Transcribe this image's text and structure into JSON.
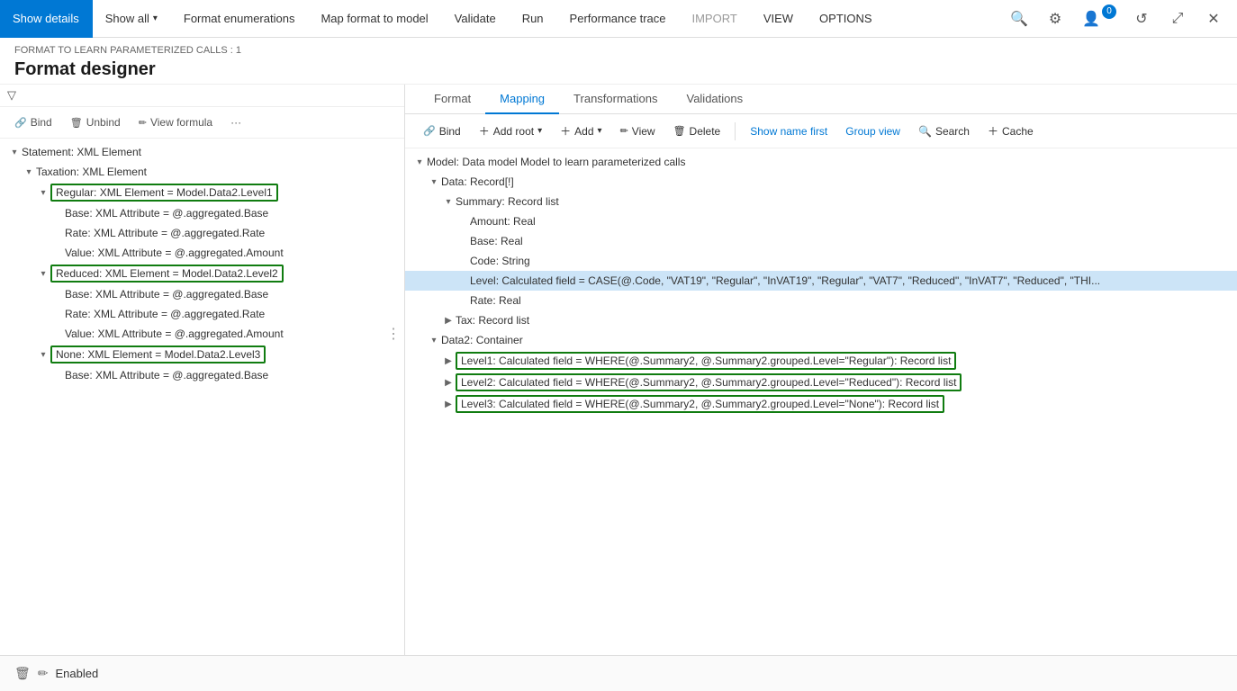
{
  "topbar": {
    "items": [
      {
        "id": "show-details",
        "label": "Show details",
        "active": true
      },
      {
        "id": "show-all",
        "label": "Show all",
        "has_caret": true,
        "active": false
      },
      {
        "id": "format-enumerations",
        "label": "Format enumerations",
        "active": false
      },
      {
        "id": "map-format-to-model",
        "label": "Map format to model",
        "active": false
      },
      {
        "id": "validate",
        "label": "Validate",
        "active": false
      },
      {
        "id": "run",
        "label": "Run",
        "active": false
      },
      {
        "id": "performance-trace",
        "label": "Performance trace",
        "active": false
      },
      {
        "id": "import",
        "label": "IMPORT",
        "muted": true,
        "active": false
      },
      {
        "id": "view",
        "label": "VIEW",
        "muted": false,
        "active": false
      },
      {
        "id": "options",
        "label": "OPTIONS",
        "muted": false,
        "active": false
      }
    ],
    "search_icon": "🔍",
    "settings_icon": "⚙",
    "user_icon": "👤",
    "notification_count": "0",
    "refresh_icon": "↺",
    "external_icon": "⤢",
    "close_icon": "✕"
  },
  "subheader": {
    "breadcrumb": "FORMAT TO LEARN PARAMETERIZED CALLS : 1",
    "title": "Format designer"
  },
  "left_toolbar": {
    "bind_label": "Bind",
    "unbind_label": "Unbind",
    "view_formula_label": "View formula",
    "more_label": "···"
  },
  "left_tree": {
    "items": [
      {
        "id": "statement",
        "label": "Statement: XML Element",
        "indent": 0,
        "toggle": "▾",
        "boxed": false
      },
      {
        "id": "taxation",
        "label": "Taxation: XML Element",
        "indent": 1,
        "toggle": "▾",
        "boxed": false
      },
      {
        "id": "regular",
        "label": "Regular: XML Element = Model.Data2.Level1",
        "indent": 2,
        "toggle": "▾",
        "boxed": true
      },
      {
        "id": "base1",
        "label": "Base: XML Attribute = @.aggregated.Base",
        "indent": 3,
        "toggle": "",
        "boxed": false
      },
      {
        "id": "rate1",
        "label": "Rate: XML Attribute = @.aggregated.Rate",
        "indent": 3,
        "toggle": "",
        "boxed": false
      },
      {
        "id": "value1",
        "label": "Value: XML Attribute = @.aggregated.Amount",
        "indent": 3,
        "toggle": "",
        "boxed": false
      },
      {
        "id": "reduced",
        "label": "Reduced: XML Element = Model.Data2.Level2",
        "indent": 2,
        "toggle": "▾",
        "boxed": true
      },
      {
        "id": "base2",
        "label": "Base: XML Attribute = @.aggregated.Base",
        "indent": 3,
        "toggle": "",
        "boxed": false
      },
      {
        "id": "rate2",
        "label": "Rate: XML Attribute = @.aggregated.Rate",
        "indent": 3,
        "toggle": "",
        "boxed": false
      },
      {
        "id": "value2",
        "label": "Value: XML Attribute = @.aggregated.Amount",
        "indent": 3,
        "toggle": "",
        "boxed": false
      },
      {
        "id": "none",
        "label": "None: XML Element = Model.Data2.Level3",
        "indent": 2,
        "toggle": "▾",
        "boxed": true
      },
      {
        "id": "base3",
        "label": "Base: XML Attribute = @.aggregated.Base",
        "indent": 3,
        "toggle": "",
        "boxed": false
      }
    ]
  },
  "right_tabs": [
    {
      "id": "format",
      "label": "Format",
      "active": false
    },
    {
      "id": "mapping",
      "label": "Mapping",
      "active": true
    },
    {
      "id": "transformations",
      "label": "Transformations",
      "active": false
    },
    {
      "id": "validations",
      "label": "Validations",
      "active": false
    }
  ],
  "right_toolbar": {
    "bind_label": "Bind",
    "add_root_label": "Add root",
    "add_label": "Add",
    "view_label": "View",
    "delete_label": "Delete",
    "show_name_first_label": "Show name first",
    "group_view_label": "Group view",
    "search_label": "Search",
    "cache_label": "Cache"
  },
  "right_tree": {
    "items": [
      {
        "id": "model-root",
        "label": "Model: Data model Model to learn parameterized calls",
        "indent": 0,
        "toggle": "▾",
        "boxed": false,
        "highlighted": false
      },
      {
        "id": "data-record",
        "label": "Data: Record[!]",
        "indent": 1,
        "toggle": "▾",
        "boxed": false,
        "highlighted": false
      },
      {
        "id": "summary-list",
        "label": "Summary: Record list",
        "indent": 2,
        "toggle": "▾",
        "boxed": false,
        "highlighted": false
      },
      {
        "id": "amount",
        "label": "Amount: Real",
        "indent": 3,
        "toggle": "",
        "boxed": false,
        "highlighted": false
      },
      {
        "id": "base-real",
        "label": "Base: Real",
        "indent": 3,
        "toggle": "",
        "boxed": false,
        "highlighted": false
      },
      {
        "id": "code-string",
        "label": "Code: String",
        "indent": 3,
        "toggle": "",
        "boxed": false,
        "highlighted": false
      },
      {
        "id": "level-calc",
        "label": "Level: Calculated field = CASE(@.Code, \"VAT19\", \"Regular\", \"InVAT19\", \"Regular\", \"VAT7\", \"Reduced\", \"InVAT7\", \"Reduced\", \"THI",
        "indent": 3,
        "toggle": "",
        "boxed": false,
        "highlighted": true
      },
      {
        "id": "rate-real",
        "label": "Rate: Real",
        "indent": 3,
        "toggle": "",
        "boxed": false,
        "highlighted": false
      },
      {
        "id": "tax-list",
        "label": "Tax: Record list",
        "indent": 2,
        "toggle": "▶",
        "boxed": false,
        "highlighted": false
      },
      {
        "id": "data2-container",
        "label": "Data2: Container",
        "indent": 1,
        "toggle": "▾",
        "boxed": false,
        "highlighted": false
      },
      {
        "id": "level1-calc",
        "label": "Level1: Calculated field = WHERE(@.Summary2, @.Summary2.grouped.Level=\"Regular\"): Record list",
        "indent": 2,
        "toggle": "▶",
        "boxed": true,
        "highlighted": false
      },
      {
        "id": "level2-calc",
        "label": "Level2: Calculated field = WHERE(@.Summary2, @.Summary2.grouped.Level=\"Reduced\"): Record list",
        "indent": 2,
        "toggle": "▶",
        "boxed": true,
        "highlighted": false
      },
      {
        "id": "level3-calc",
        "label": "Level3: Calculated field = WHERE(@.Summary2, @.Summary2.grouped.Level=\"None\"): Record list",
        "indent": 2,
        "toggle": "▶",
        "boxed": true,
        "highlighted": false
      }
    ]
  },
  "bottom_bar": {
    "delete_icon": "🗑",
    "edit_icon": "✏",
    "status_label": "Enabled"
  }
}
